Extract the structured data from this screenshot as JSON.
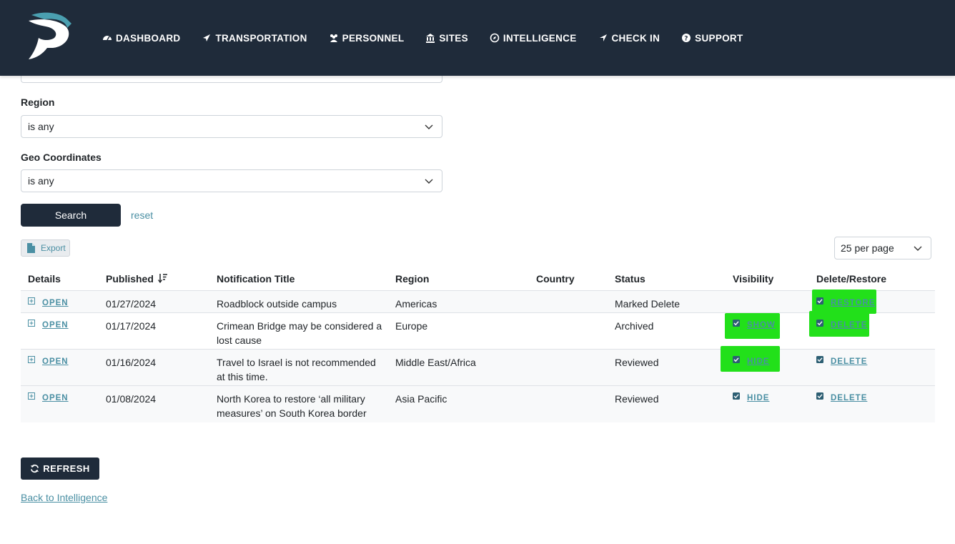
{
  "nav": {
    "items": [
      {
        "label": "DASHBOARD",
        "icon": "dashboard-icon"
      },
      {
        "label": "TRANSPORTATION",
        "icon": "plane-icon"
      },
      {
        "label": "PERSONNEL",
        "icon": "users-icon"
      },
      {
        "label": "SITES",
        "icon": "building-icon"
      },
      {
        "label": "INTELLIGENCE",
        "icon": "compass-icon"
      },
      {
        "label": "CHECK IN",
        "icon": "location-arrow-icon"
      },
      {
        "label": "SUPPORT",
        "icon": "question-circle-icon"
      }
    ]
  },
  "filters": {
    "region_label": "Region",
    "region_value": "is any",
    "geo_label": "Geo Coordinates",
    "geo_value": "is any",
    "search_label": "Search",
    "reset_label": "reset"
  },
  "toolbar": {
    "export_label": "Export",
    "per_page": "25 per page"
  },
  "table": {
    "headers": [
      "Details",
      "Published",
      "Notification Title",
      "Region",
      "Country",
      "Status",
      "Visibility",
      "Delete/Restore"
    ],
    "rows": [
      {
        "details": "OPEN",
        "published": "01/27/2024",
        "title": "Roadblock outside campus",
        "region": "Americas",
        "country": "",
        "status": "Marked Delete",
        "visibility": "",
        "action": "RESTORE"
      },
      {
        "details": "OPEN",
        "published": "01/17/2024",
        "title": "Crimean Bridge may be considered a lost cause",
        "region": "Europe",
        "country": "",
        "status": "Archived",
        "visibility": "SHOW",
        "action": "DELETE"
      },
      {
        "details": "OPEN",
        "published": "01/16/2024",
        "title": "Travel to Israel is not recommended at this time.",
        "region": "Middle East/Africa",
        "country": "",
        "status": "Reviewed",
        "visibility": "HIDE",
        "action": "DELETE"
      },
      {
        "details": "OPEN",
        "published": "01/08/2024",
        "title": "North Korea to restore ‘all military measures’ on South Korea border",
        "region": "Asia Pacific",
        "country": "",
        "status": "Reviewed",
        "visibility": "HIDE",
        "action": "DELETE"
      }
    ]
  },
  "footer": {
    "refresh_label": "REFRESH",
    "back_label": "Back to Intelligence"
  },
  "colors": {
    "nav_bg": "#1f2b3a",
    "accent": "#4a8fa3",
    "highlight": "#22e01a"
  }
}
